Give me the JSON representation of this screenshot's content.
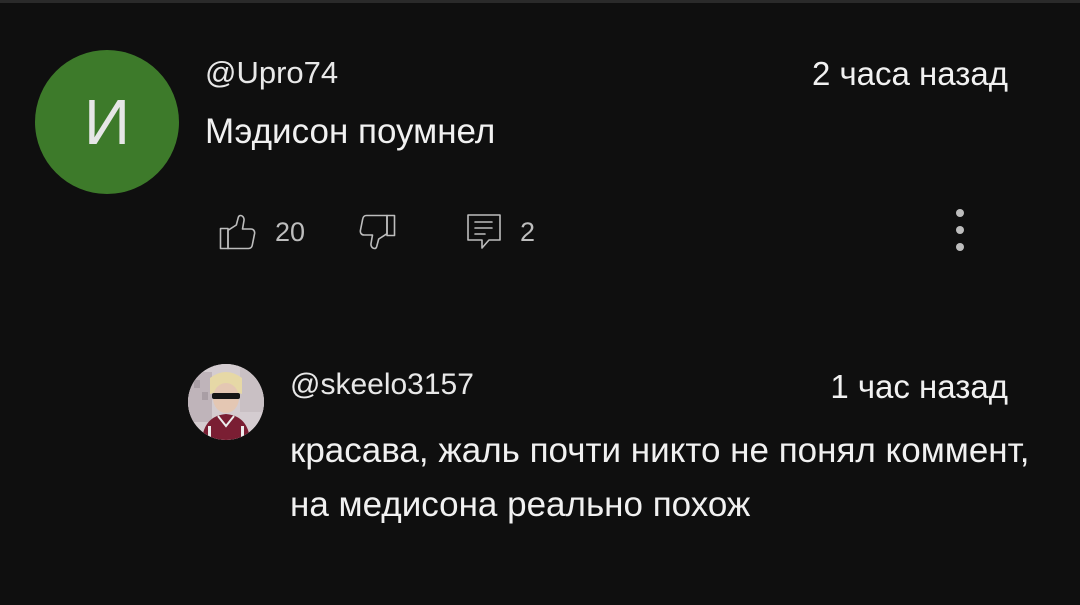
{
  "comment": {
    "avatar_letter": "И",
    "avatar_color": "#3d7a2a",
    "author": "@Upro74",
    "time": "2 часа назад",
    "text": "Мэдисон поумнел",
    "likes": "20",
    "replies": "2",
    "icons": [
      "thumb-up-icon",
      "thumb-down-icon",
      "reply-icon",
      "more-vert-icon"
    ]
  },
  "reply": {
    "author": "@skeelo3157",
    "time": "1 час назад",
    "text": "красава, жаль почти никто не понял коммент, на медисона реально похож"
  },
  "colors": {
    "background": "#0f0f0f",
    "primary_text": "#f1f1f1",
    "secondary_text": "#bdbdbd"
  }
}
